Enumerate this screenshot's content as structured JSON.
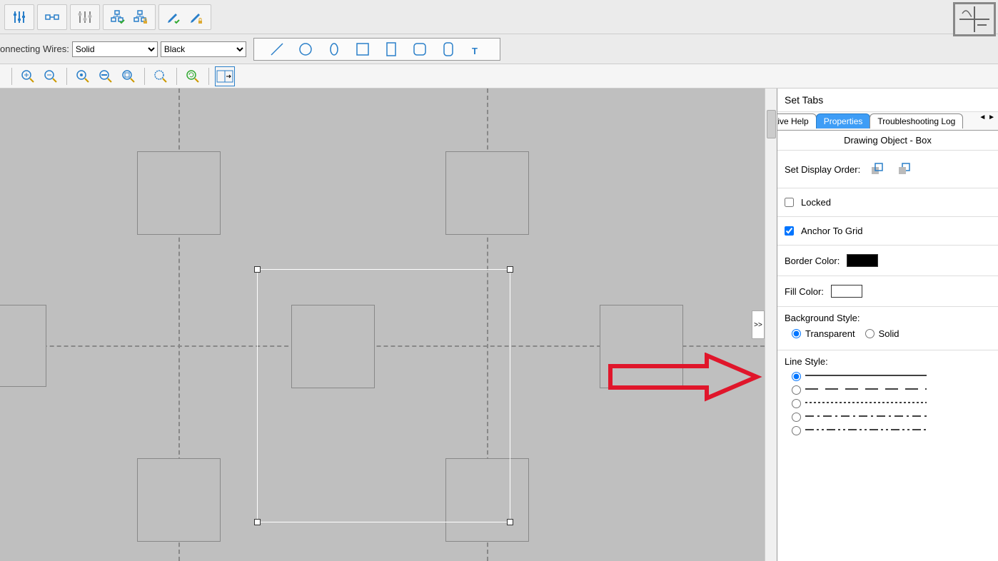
{
  "toolbar": {
    "connecting_wires_label": "onnecting Wires:",
    "style_select": "Solid",
    "color_select": "Black"
  },
  "panel": {
    "set_tabs": "Set Tabs",
    "tabs": {
      "help": "tive Help",
      "properties": "Properties",
      "troubleshoot": "Troubleshooting Log"
    },
    "title": "Drawing Object - Box",
    "display_order": "Set Display Order:",
    "locked": "Locked",
    "anchor": "Anchor To Grid",
    "border_color": "Border Color:",
    "fill_color": "Fill Color:",
    "bg_style": "Background Style:",
    "bg_transparent": "Transparent",
    "bg_solid": "Solid",
    "line_style": "Line Style:",
    "border_color_value": "#000000",
    "fill_color_value": "#ffffff"
  },
  "collapse": ">>",
  "nav_arrows": "◄ ►"
}
